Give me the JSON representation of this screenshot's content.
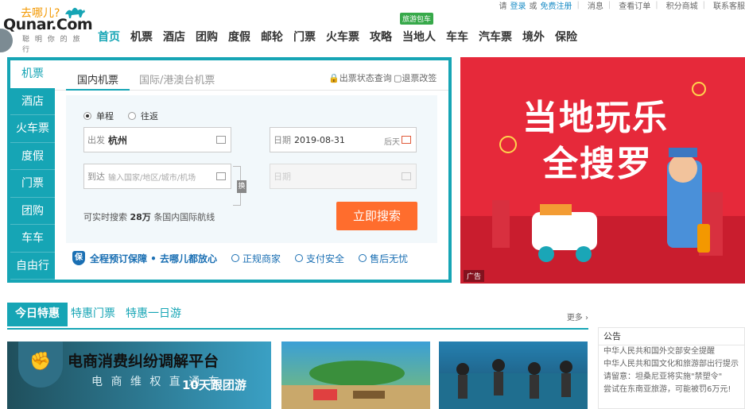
{
  "util": {
    "login_prompt": "请",
    "login": "登录",
    "or": "或",
    "register": "免费注册",
    "messages": "消息",
    "orders": "查看订单",
    "points": "积分商城",
    "service": "联系客服"
  },
  "logo": {
    "cn": "去哪儿?",
    "en": "Qunar.Com",
    "slogan": "聪 明 你 的 旅 行"
  },
  "nav": {
    "items": [
      "首页",
      "机票",
      "酒店",
      "团购",
      "度假",
      "邮轮",
      "门票",
      "火车票",
      "攻略",
      "当地人",
      "车车",
      "汽车票",
      "境外",
      "保险"
    ],
    "badge": "旅游包车"
  },
  "search": {
    "vtabs": [
      "机票",
      "酒店",
      "火车票",
      "度假",
      "门票",
      "团购",
      "车车",
      "自由行"
    ],
    "htabs": [
      "国内机票",
      "国际/港澳台机票"
    ],
    "status_link": "出票状态查询",
    "refund_link": "退票改签",
    "trip_one": "单程",
    "trip_round": "往返",
    "from_label": "出发",
    "from_value": "杭州",
    "to_label": "到达",
    "to_placeholder": "输入国家/地区/城市/机场",
    "date_label": "日期",
    "date_value": "2019-08-31",
    "date_hint": "后天",
    "return_label": "日期",
    "swap": "换",
    "count_prefix": "可实时搜索",
    "count_value": "28万",
    "count_suffix": "条国内国际航线",
    "search_button": "立即搜索",
    "assure_main": "全程预订保障 • 去哪儿都放心",
    "assure_1": "正规商家",
    "assure_2": "支付安全",
    "assure_3": "售后无忧",
    "shield_char": "保"
  },
  "banner": {
    "line1": "当地玩乐",
    "line2": "全搜罗",
    "ad": "广告"
  },
  "deals": {
    "tabs": [
      "今日特惠",
      "特惠门票",
      "特惠一日游"
    ],
    "more": "更多",
    "card1_title": "电商消费纠纷调解平台",
    "card1_sub": "电 商 维 权 直 通 车",
    "card1_overlay": "10天跟团游"
  },
  "notice": {
    "title": "公告",
    "lines": [
      "中华人民共和国外交部安全提醒",
      "中华人民共和国文化和旅游部出行提示",
      "请留意：坦桑尼亚将实施\"禁塑令\"",
      "尝试在东南亚旅游，可能被罚6万元!"
    ]
  },
  "colors": {
    "accent": "#16a5b5",
    "button": "#ff6d2d",
    "banner": "#e6293a"
  }
}
